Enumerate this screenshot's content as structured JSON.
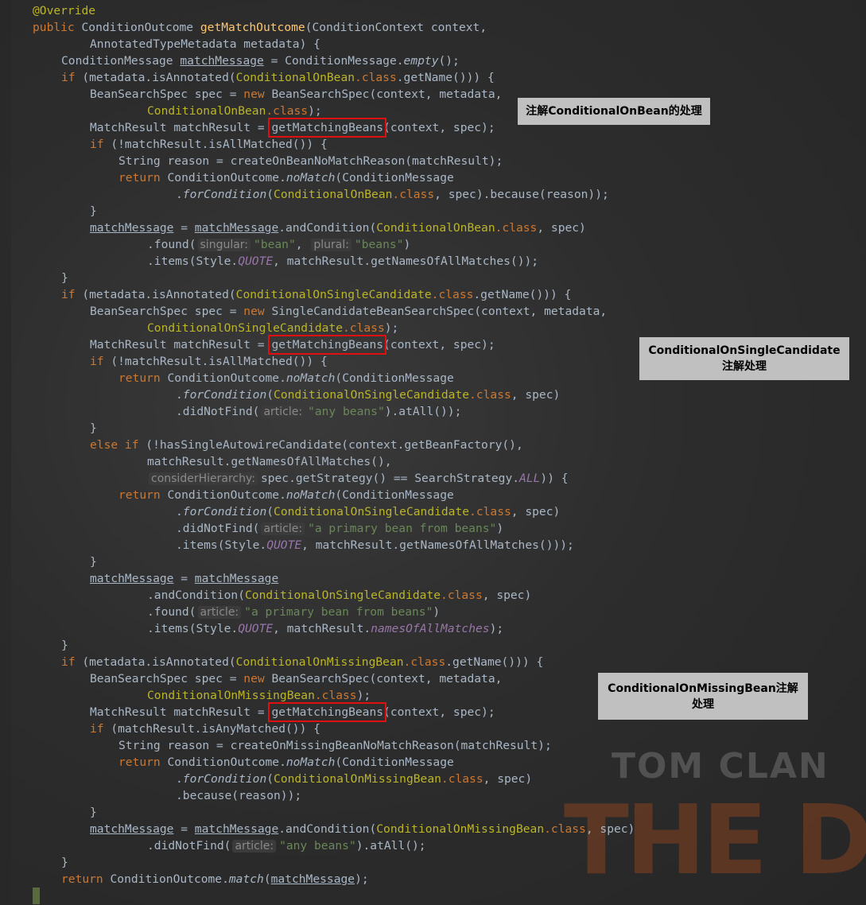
{
  "logo_text": [
    "TOM CLAN",
    "THE DIV"
  ],
  "colors": {
    "keyword": "#cc7832",
    "method": "#ffc66d",
    "annotation_class": "#bbb529",
    "string": "#6a8759",
    "constant": "#9876aa",
    "text": "#a9b7c6",
    "highlight_box": "#e01010",
    "note_bg": "#c0c0c0"
  },
  "notes": [
    "注解ConditionalOnBean的处理",
    "ConditionalOnSingleCandidate\n注解处理",
    "ConditionalOnMissingBean注解\n处理"
  ],
  "code": {
    "lines": [
      [
        0,
        [
          [
            "an",
            "@Override"
          ]
        ]
      ],
      [
        0,
        [
          [
            "k",
            "public "
          ],
          [
            "t",
            "ConditionOutcome "
          ],
          [
            "m",
            "getMatchOutcome"
          ],
          [
            "t",
            "(ConditionContext context,"
          ]
        ]
      ],
      [
        8,
        [
          [
            "t",
            "AnnotatedTypeMetadata metadata) {"
          ]
        ]
      ],
      [
        4,
        [
          [
            "t",
            "ConditionMessage "
          ],
          [
            "u",
            "matchMessage"
          ],
          [
            "t",
            " = ConditionMessage."
          ],
          [
            "st",
            "empty"
          ],
          [
            "t",
            "();"
          ]
        ]
      ],
      [
        4,
        [
          [
            "k",
            "if "
          ],
          [
            "t",
            "(metadata.isAnnotated("
          ],
          [
            "a",
            "ConditionalOnBean"
          ],
          [
            "k",
            ".class"
          ],
          [
            "t",
            ".getName())) {"
          ]
        ]
      ],
      [
        8,
        [
          [
            "t",
            "BeanSearchSpec spec = "
          ],
          [
            "k",
            "new "
          ],
          [
            "t",
            "BeanSearchSpec(context, metadata,"
          ]
        ]
      ],
      [
        16,
        [
          [
            "a",
            "ConditionalOnBean"
          ],
          [
            "k",
            ".class"
          ],
          [
            "t",
            ");"
          ]
        ]
      ],
      [
        8,
        [
          [
            "t",
            "MatchResult matchResult = "
          ],
          [
            "box",
            "getMatchingBeans"
          ],
          [
            "t",
            "(context, spec);"
          ]
        ]
      ],
      [
        8,
        [
          [
            "k",
            "if "
          ],
          [
            "t",
            "(!matchResult.isAllMatched()) {"
          ]
        ]
      ],
      [
        12,
        [
          [
            "t",
            "String reason = createOnBeanNoMatchReason(matchResult);"
          ]
        ]
      ],
      [
        12,
        [
          [
            "k",
            "return "
          ],
          [
            "t",
            "ConditionOutcome."
          ],
          [
            "st",
            "noMatch"
          ],
          [
            "t",
            "(ConditionMessage"
          ]
        ]
      ],
      [
        20,
        [
          [
            "t",
            "."
          ],
          [
            "st",
            "forCondition"
          ],
          [
            "t",
            "("
          ],
          [
            "a",
            "ConditionalOnBean"
          ],
          [
            "k",
            ".class"
          ],
          [
            "t",
            ", spec).because(reason));"
          ]
        ]
      ],
      [
        8,
        [
          [
            "t",
            "}"
          ]
        ]
      ],
      [
        8,
        [
          [
            "u",
            "matchMessage"
          ],
          [
            "t",
            " = "
          ],
          [
            "u",
            "matchMessage"
          ],
          [
            "t",
            ".andCondition("
          ],
          [
            "a",
            "ConditionalOnBean"
          ],
          [
            "k",
            ".class"
          ],
          [
            "t",
            ", spec)"
          ]
        ]
      ],
      [
        16,
        [
          [
            "t",
            ".found("
          ],
          [
            "h",
            "singular:"
          ],
          [
            "s",
            "\"bean\""
          ],
          [
            "t",
            ", "
          ],
          [
            "h",
            "plural:"
          ],
          [
            "s",
            "\"beans\""
          ],
          [
            "t",
            ")"
          ]
        ]
      ],
      [
        16,
        [
          [
            "t",
            ".items(Style."
          ],
          [
            "c",
            "QUOTE"
          ],
          [
            "t",
            ", matchResult.getNamesOfAllMatches());"
          ]
        ]
      ],
      [
        4,
        [
          [
            "t",
            "}"
          ]
        ]
      ],
      [
        4,
        [
          [
            "k",
            "if "
          ],
          [
            "t",
            "(metadata.isAnnotated("
          ],
          [
            "a",
            "ConditionalOnSingleCandidate"
          ],
          [
            "k",
            ".class"
          ],
          [
            "t",
            ".getName())) {"
          ]
        ]
      ],
      [
        8,
        [
          [
            "t",
            "BeanSearchSpec spec = "
          ],
          [
            "k",
            "new "
          ],
          [
            "t",
            "SingleCandidateBeanSearchSpec(context, metadata,"
          ]
        ]
      ],
      [
        16,
        [
          [
            "a",
            "ConditionalOnSingleCandidate"
          ],
          [
            "k",
            ".class"
          ],
          [
            "t",
            ");"
          ]
        ]
      ],
      [
        8,
        [
          [
            "t",
            "MatchResult matchResult = "
          ],
          [
            "box",
            "getMatchingBeans"
          ],
          [
            "t",
            "(context, spec);"
          ]
        ]
      ],
      [
        8,
        [
          [
            "k",
            "if "
          ],
          [
            "t",
            "(!matchResult.isAllMatched()) {"
          ]
        ]
      ],
      [
        12,
        [
          [
            "k",
            "return "
          ],
          [
            "t",
            "ConditionOutcome."
          ],
          [
            "st",
            "noMatch"
          ],
          [
            "t",
            "(ConditionMessage"
          ]
        ]
      ],
      [
        20,
        [
          [
            "t",
            "."
          ],
          [
            "st",
            "forCondition"
          ],
          [
            "t",
            "("
          ],
          [
            "a",
            "ConditionalOnSingleCandidate"
          ],
          [
            "k",
            ".class"
          ],
          [
            "t",
            ", spec)"
          ]
        ]
      ],
      [
        20,
        [
          [
            "t",
            ".didNotFind("
          ],
          [
            "h",
            "article:"
          ],
          [
            "s",
            "\"any beans\""
          ],
          [
            "t",
            ").atAll());"
          ]
        ]
      ],
      [
        8,
        [
          [
            "t",
            "}"
          ]
        ]
      ],
      [
        8,
        [
          [
            "k",
            "else if "
          ],
          [
            "t",
            "(!hasSingleAutowireCandidate(context.getBeanFactory(),"
          ]
        ]
      ],
      [
        16,
        [
          [
            "t",
            "matchResult.getNamesOfAllMatches(),"
          ]
        ]
      ],
      [
        16,
        [
          [
            "h",
            "considerHierarchy:"
          ],
          [
            "t",
            "spec.getStrategy() == SearchStrategy."
          ],
          [
            "c",
            "ALL"
          ],
          [
            "t",
            ")) {"
          ]
        ]
      ],
      [
        12,
        [
          [
            "k",
            "return "
          ],
          [
            "t",
            "ConditionOutcome."
          ],
          [
            "st",
            "noMatch"
          ],
          [
            "t",
            "(ConditionMessage"
          ]
        ]
      ],
      [
        20,
        [
          [
            "t",
            "."
          ],
          [
            "st",
            "forCondition"
          ],
          [
            "t",
            "("
          ],
          [
            "a",
            "ConditionalOnSingleCandidate"
          ],
          [
            "k",
            ".class"
          ],
          [
            "t",
            ", spec)"
          ]
        ]
      ],
      [
        20,
        [
          [
            "t",
            ".didNotFind("
          ],
          [
            "h",
            "article:"
          ],
          [
            "s",
            "\"a primary bean from beans\""
          ],
          [
            "t",
            ")"
          ]
        ]
      ],
      [
        20,
        [
          [
            "t",
            ".items(Style."
          ],
          [
            "c",
            "QUOTE"
          ],
          [
            "t",
            ", matchResult.getNamesOfAllMatches()));"
          ]
        ]
      ],
      [
        8,
        [
          [
            "t",
            "}"
          ]
        ]
      ],
      [
        8,
        [
          [
            "u",
            "matchMessage"
          ],
          [
            "t",
            " = "
          ],
          [
            "u",
            "matchMessage"
          ]
        ]
      ],
      [
        16,
        [
          [
            "t",
            ".andCondition("
          ],
          [
            "a",
            "ConditionalOnSingleCandidate"
          ],
          [
            "k",
            ".class"
          ],
          [
            "t",
            ", spec)"
          ]
        ]
      ],
      [
        16,
        [
          [
            "t",
            ".found("
          ],
          [
            "h",
            "article:"
          ],
          [
            "s",
            "\"a primary bean from beans\""
          ],
          [
            "t",
            ")"
          ]
        ]
      ],
      [
        16,
        [
          [
            "t",
            ".items(Style."
          ],
          [
            "c",
            "QUOTE"
          ],
          [
            "t",
            ", matchResult."
          ],
          [
            "c",
            "namesOfAllMatches"
          ],
          [
            "t",
            ");"
          ]
        ]
      ],
      [
        4,
        [
          [
            "t",
            "}"
          ]
        ]
      ],
      [
        4,
        [
          [
            "k",
            "if "
          ],
          [
            "t",
            "(metadata.isAnnotated("
          ],
          [
            "a",
            "ConditionalOnMissingBean"
          ],
          [
            "k",
            ".class"
          ],
          [
            "t",
            ".getName())) {"
          ]
        ]
      ],
      [
        8,
        [
          [
            "t",
            "BeanSearchSpec spec = "
          ],
          [
            "k",
            "new "
          ],
          [
            "t",
            "BeanSearchSpec(context, metadata,"
          ]
        ]
      ],
      [
        16,
        [
          [
            "a",
            "ConditionalOnMissingBean"
          ],
          [
            "k",
            ".class"
          ],
          [
            "t",
            ");"
          ]
        ]
      ],
      [
        8,
        [
          [
            "t",
            "MatchResult matchResult = "
          ],
          [
            "box",
            "getMatchingBeans"
          ],
          [
            "t",
            "(context, spec);"
          ]
        ]
      ],
      [
        8,
        [
          [
            "k",
            "if "
          ],
          [
            "t",
            "(matchResult.isAnyMatched()) {"
          ]
        ]
      ],
      [
        12,
        [
          [
            "t",
            "String reason = createOnMissingBeanNoMatchReason(matchResult);"
          ]
        ]
      ],
      [
        12,
        [
          [
            "k",
            "return "
          ],
          [
            "t",
            "ConditionOutcome."
          ],
          [
            "st",
            "noMatch"
          ],
          [
            "t",
            "(ConditionMessage"
          ]
        ]
      ],
      [
        20,
        [
          [
            "t",
            "."
          ],
          [
            "st",
            "forCondition"
          ],
          [
            "t",
            "("
          ],
          [
            "a",
            "ConditionalOnMissingBean"
          ],
          [
            "k",
            ".class"
          ],
          [
            "t",
            ", spec)"
          ]
        ]
      ],
      [
        20,
        [
          [
            "t",
            ".because(reason));"
          ]
        ]
      ],
      [
        8,
        [
          [
            "t",
            "}"
          ]
        ]
      ],
      [
        8,
        [
          [
            "u",
            "matchMessage"
          ],
          [
            "t",
            " = "
          ],
          [
            "u",
            "matchMessage"
          ],
          [
            "t",
            ".andCondition("
          ],
          [
            "a",
            "ConditionalOnMissingBean"
          ],
          [
            "k",
            ".class"
          ],
          [
            "t",
            ", spec)"
          ]
        ]
      ],
      [
        16,
        [
          [
            "t",
            ".didNotFind("
          ],
          [
            "h",
            "article:"
          ],
          [
            "s",
            "\"any beans\""
          ],
          [
            "t",
            ").atAll();"
          ]
        ]
      ],
      [
        4,
        [
          [
            "t",
            "}"
          ]
        ]
      ],
      [
        4,
        [
          [
            "k",
            "return "
          ],
          [
            "t",
            "ConditionOutcome."
          ],
          [
            "st",
            "match"
          ],
          [
            "t",
            "("
          ],
          [
            "u",
            "matchMessage"
          ],
          [
            "t",
            ");"
          ]
        ]
      ],
      [
        0,
        [
          [
            "t",
            "}"
          ]
        ]
      ]
    ]
  }
}
